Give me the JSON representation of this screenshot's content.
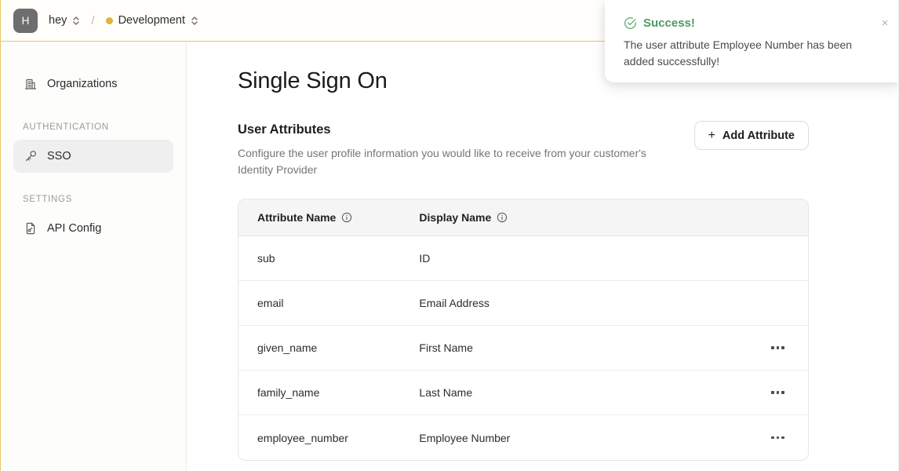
{
  "topbar": {
    "avatar_initial": "H",
    "workspace": "hey",
    "separator": "/",
    "environment": "Development",
    "environment_dot_color": "#e0b23e",
    "workspace_switcher_icon": "chevron-up-down-icon",
    "environment_switcher_icon": "chevron-up-down-icon"
  },
  "sidebar": {
    "items": [
      {
        "label": "Organizations",
        "icon": "building-icon",
        "active": false
      },
      {
        "label": "SSO",
        "icon": "key-icon",
        "active": true
      },
      {
        "label": "API Config",
        "icon": "file-node-icon",
        "active": false
      }
    ],
    "sections": {
      "authentication": "AUTHENTICATION",
      "settings": "SETTINGS"
    }
  },
  "main": {
    "page_title": "Single Sign On",
    "section_title": "User Attributes",
    "section_description": "Configure the user profile information you would like to receive from your customer's Identity Provider",
    "add_button": {
      "label": "Add Attribute",
      "icon": "plus-icon"
    },
    "table": {
      "columns": [
        {
          "label": "Attribute Name",
          "info_icon": "info-circle-icon"
        },
        {
          "label": "Display Name",
          "info_icon": "info-circle-icon"
        }
      ],
      "rows": [
        {
          "attribute_name": "sub",
          "display_name": "ID",
          "has_menu": false
        },
        {
          "attribute_name": "email",
          "display_name": "Email Address",
          "has_menu": false
        },
        {
          "attribute_name": "given_name",
          "display_name": "First Name",
          "has_menu": true
        },
        {
          "attribute_name": "family_name",
          "display_name": "Last Name",
          "has_menu": true
        },
        {
          "attribute_name": "employee_number",
          "display_name": "Employee Number",
          "has_menu": true
        }
      ],
      "row_menu_icon": "ellipsis-icon"
    }
  },
  "toast": {
    "icon": "check-circle-icon",
    "title": "Success!",
    "message": "The user attribute Employee Number has been added successfully!",
    "close_label": "×",
    "title_color": "#4e9a63"
  }
}
